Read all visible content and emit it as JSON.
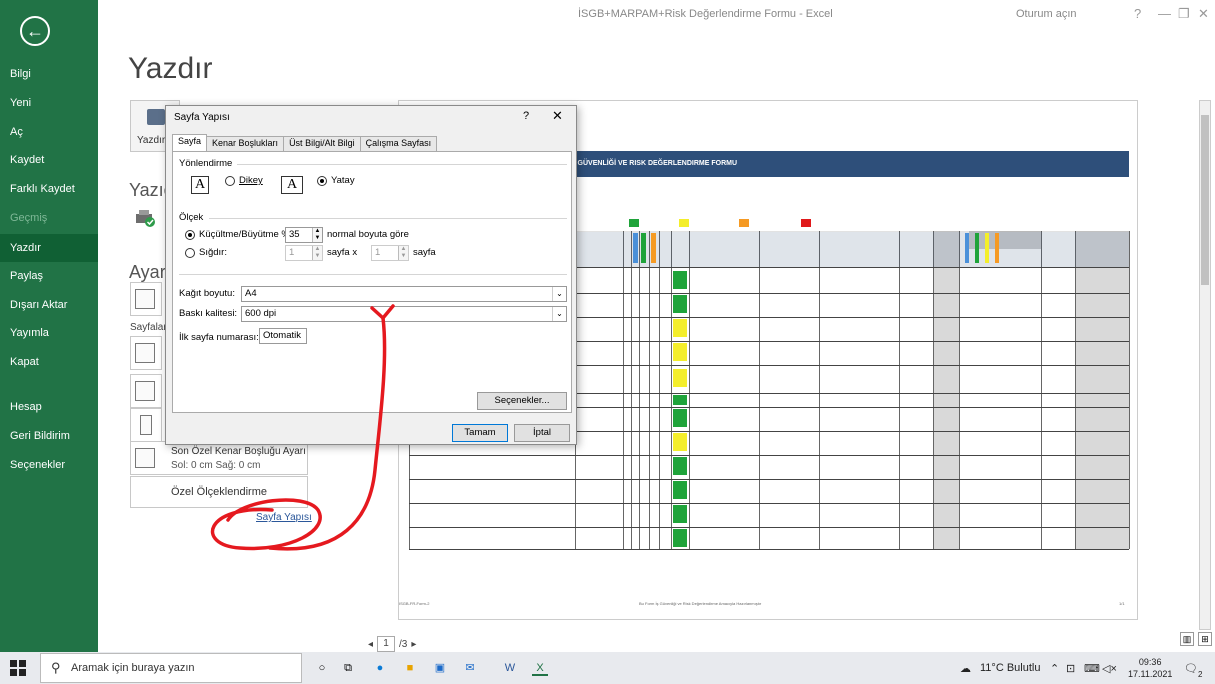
{
  "window": {
    "title": "İSGB+MARPAM+Risk Değerlendirme Formu  -  Excel",
    "sign_in": "Oturum açın",
    "help": "?",
    "minimize": "—",
    "restore": "❐",
    "close": "✕"
  },
  "sidebar": {
    "back": "←",
    "items": [
      {
        "label": "Bilgi"
      },
      {
        "label": "Yeni"
      },
      {
        "label": "Aç"
      },
      {
        "label": "Kaydet"
      },
      {
        "label": "Farklı Kaydet"
      },
      {
        "label": "Geçmiş"
      },
      {
        "label": "Yazdır"
      },
      {
        "label": "Paylaş"
      },
      {
        "label": "Dışarı Aktar"
      },
      {
        "label": "Yayımla"
      },
      {
        "label": "Kapat"
      },
      {
        "label": "Hesap"
      },
      {
        "label": "Geri Bildirim"
      },
      {
        "label": "Seçenekler"
      }
    ]
  },
  "print": {
    "heading": "Yazdır",
    "print_button": "Yazdır",
    "printer_heading": "Yazıcı",
    "settings_heading": "Ayarlar",
    "pages_label": "Sayfalar:",
    "margin_setting_title": "Son Özel Kenar Boşluğu Ayarı",
    "margin_setting_sub": "Sol: 0 cm   Sağ: 0 cm",
    "custom_scaling": "Özel Ölçeklendirme",
    "page_setup_link": "Sayfa Yapısı",
    "pager_current": "1",
    "pager_total": "/3"
  },
  "preview": {
    "form_title": "İŞ GÜVENLİĞİ VE RISK DEĞERLENDIRME FORMU",
    "footer_left": "ISGB-FR-Form-2",
    "footer_center": "Bu Form İş Güvenliği ve Risk Değerlendirme Amacıyla Hazırlanmıştır",
    "footer_right": "1/1"
  },
  "dialog": {
    "title": "Sayfa Yapısı",
    "help": "?",
    "close": "✕",
    "tabs": [
      "Sayfa",
      "Kenar Boşlukları",
      "Üst Bilgi/Alt Bilgi",
      "Çalışma Sayfası"
    ],
    "orientation_label": "Yönlendirme",
    "portrait": "Dikey",
    "landscape": "Yatay",
    "scale_label": "Ölçek",
    "adjust_to": "Küçültme/Büyütme %",
    "adjust_value": "35",
    "adjust_suffix": "normal boyuta göre",
    "fit_to": "Sığdır:",
    "fit_wide": "1",
    "fit_wide_suffix": "sayfa  x",
    "fit_tall": "1",
    "fit_tall_suffix": "sayfa",
    "paper_size_label": "Kağıt boyutu:",
    "paper_size_value": "A4",
    "print_quality_label": "Baskı kalitesi:",
    "print_quality_value": "600 dpi",
    "first_page_label": "İlk sayfa numarası:",
    "first_page_value": "Otomatik",
    "options_button": "Seçenekler...",
    "ok_button": "Tamam",
    "cancel_button": "İptal"
  },
  "taskbar": {
    "search_placeholder": "Aramak için buraya yazın",
    "weather": "11°C  Bulutlu",
    "time": "09:36",
    "date": "17.11.2021",
    "notifications": "2"
  },
  "colors": {
    "excel_green": "#217346",
    "annotation_red": "#e5191f"
  }
}
